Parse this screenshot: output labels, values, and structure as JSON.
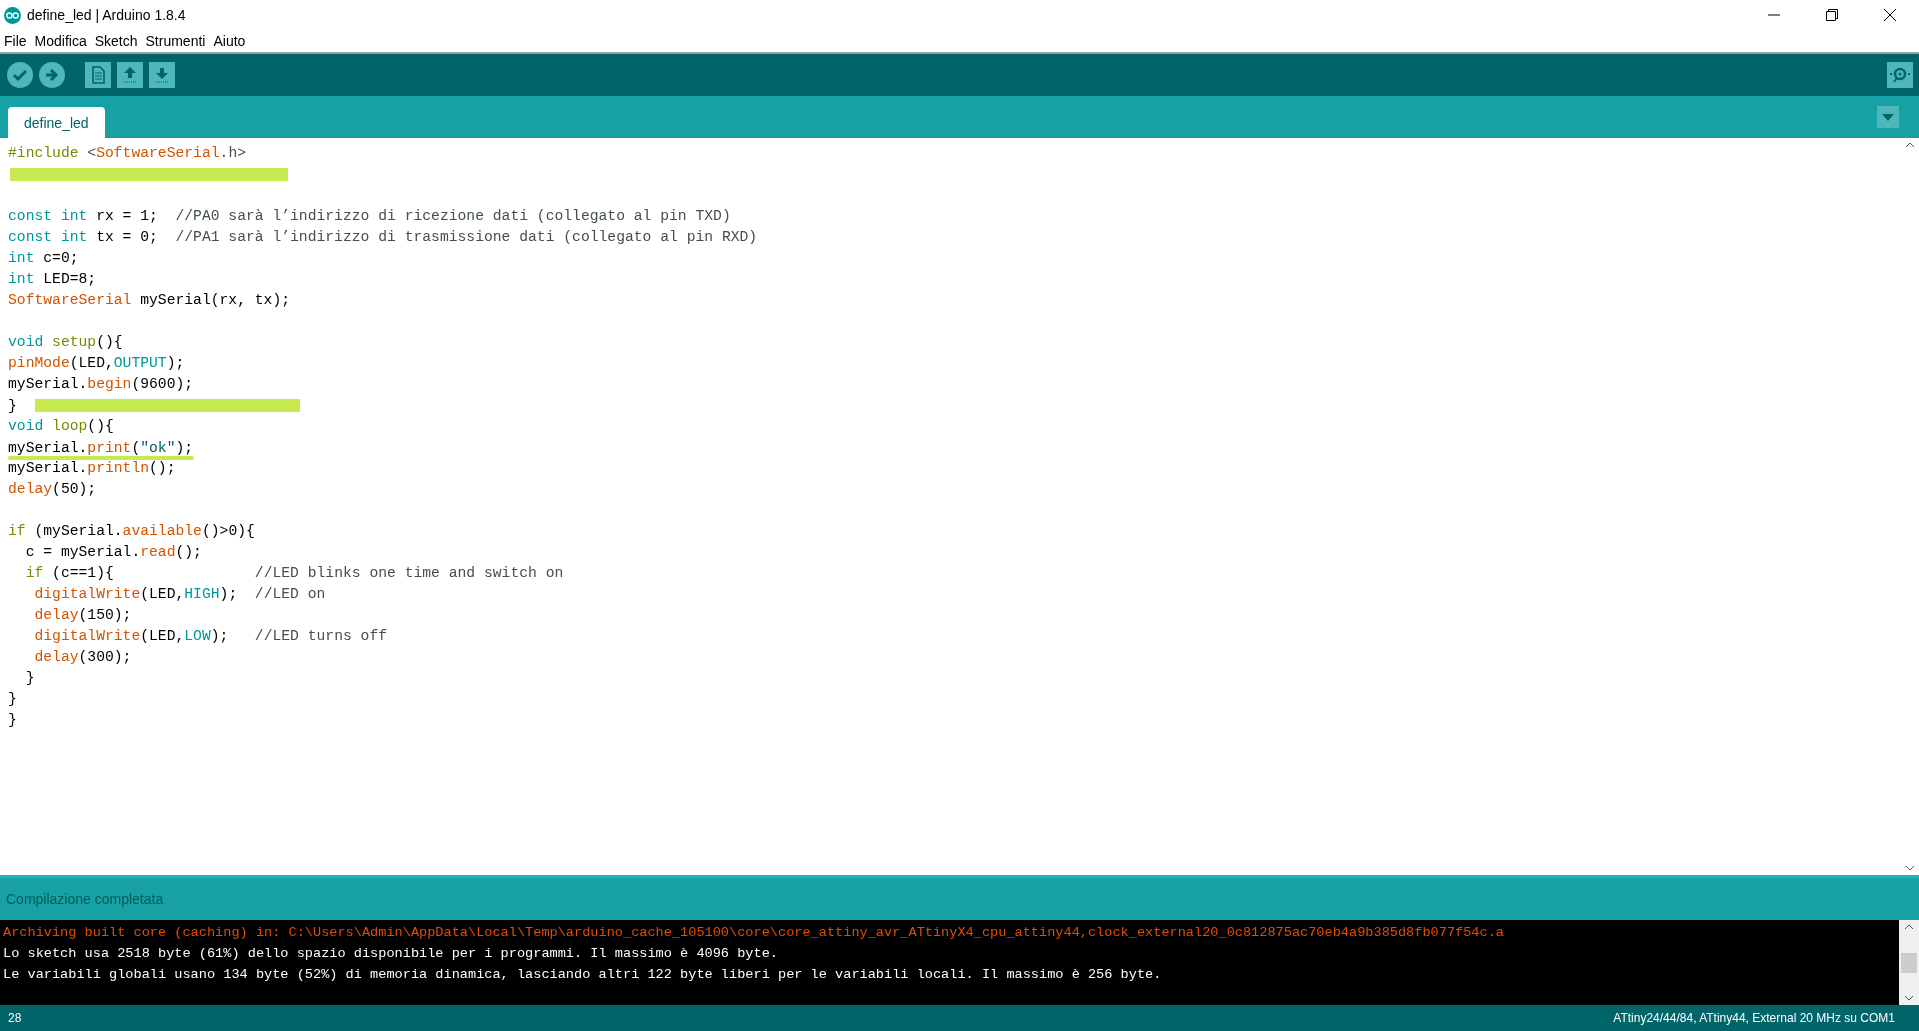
{
  "window": {
    "title": "define_led | Arduino 1.8.4"
  },
  "menu": [
    "File",
    "Modifica",
    "Sketch",
    "Strumenti",
    "Aiuto"
  ],
  "toolbar": [
    {
      "kind": "verify"
    },
    {
      "kind": "upload"
    },
    {
      "kind": "new"
    },
    {
      "kind": "open"
    },
    {
      "kind": "save"
    }
  ],
  "tabs": [
    {
      "label": "define_led",
      "selected": true
    }
  ],
  "editor": {
    "lines": [
      {
        "tokens": [
          {
            "kind": "control",
            "text": "#include"
          },
          {
            "kind": "comment",
            "text": " <"
          },
          {
            "kind": "func",
            "text": "SoftwareSerial"
          },
          {
            "kind": "comment",
            "text": ".h>"
          }
        ]
      },
      {
        "kind": "blank",
        "highlight": {
          "kind": "bar"
        }
      },
      {
        "kind": "blank"
      },
      {
        "tokens": [
          {
            "kind": "keyword",
            "text": "const int"
          },
          {
            "kind": "plain",
            "text": " rx = 1;  "
          },
          {
            "kind": "comment",
            "text": "//PA0 sarà l’indirizzo di ricezione dati (collegato al pin TXD)"
          }
        ]
      },
      {
        "tokens": [
          {
            "kind": "keyword",
            "text": "const int"
          },
          {
            "kind": "plain",
            "text": " tx = 0;  "
          },
          {
            "kind": "comment",
            "text": "//PA1 sarà l’indirizzo di trasmissione dati (collegato al pin RXD)"
          }
        ]
      },
      {
        "tokens": [
          {
            "kind": "keyword",
            "text": "int"
          },
          {
            "kind": "plain",
            "text": " c=0;"
          }
        ]
      },
      {
        "tokens": [
          {
            "kind": "keyword",
            "text": "int"
          },
          {
            "kind": "plain",
            "text": " LED=8;"
          }
        ]
      },
      {
        "tokens": [
          {
            "kind": "func",
            "text": "SoftwareSerial"
          },
          {
            "kind": "plain",
            "text": " mySerial(rx, tx);"
          }
        ]
      },
      {
        "kind": "blank"
      },
      {
        "tokens": [
          {
            "kind": "keyword",
            "text": "void "
          },
          {
            "kind": "control",
            "text": "setup"
          },
          {
            "kind": "plain",
            "text": "(){"
          }
        ]
      },
      {
        "tokens": [
          {
            "kind": "func",
            "text": "pinMode"
          },
          {
            "kind": "plain",
            "text": "(LED,"
          },
          {
            "kind": "constant",
            "text": "OUTPUT"
          },
          {
            "kind": "plain",
            "text": ");"
          }
        ]
      },
      {
        "tokens": [
          {
            "kind": "plain",
            "text": "mySerial."
          },
          {
            "kind": "func",
            "text": "begin"
          },
          {
            "kind": "plain",
            "text": "(9600);"
          }
        ]
      },
      {
        "tokens": [
          {
            "kind": "plain",
            "text": "}"
          }
        ],
        "highlight": {
          "kind": "bar"
        }
      },
      {
        "tokens": [
          {
            "kind": "keyword",
            "text": "void "
          },
          {
            "kind": "control",
            "text": "loop"
          },
          {
            "kind": "plain",
            "text": "(){"
          }
        ]
      },
      {
        "tokens": [
          {
            "kind": "plain",
            "text": "mySerial."
          },
          {
            "kind": "func",
            "text": "print"
          },
          {
            "kind": "plain",
            "text": "("
          },
          {
            "kind": "string",
            "text": "\"ok\""
          },
          {
            "kind": "plain",
            "text": ");"
          }
        ],
        "highlight": {
          "kind": "underline"
        }
      },
      {
        "tokens": [
          {
            "kind": "plain",
            "text": "mySerial."
          },
          {
            "kind": "func",
            "text": "println"
          },
          {
            "kind": "plain",
            "text": "();"
          }
        ]
      },
      {
        "tokens": [
          {
            "kind": "func",
            "text": "delay"
          },
          {
            "kind": "plain",
            "text": "(50);"
          }
        ]
      },
      {
        "kind": "blank"
      },
      {
        "tokens": [
          {
            "kind": "control",
            "text": "if"
          },
          {
            "kind": "plain",
            "text": " (mySerial."
          },
          {
            "kind": "func",
            "text": "available"
          },
          {
            "kind": "plain",
            "text": "()>0){"
          }
        ]
      },
      {
        "tokens": [
          {
            "kind": "plain",
            "text": "  c = mySerial."
          },
          {
            "kind": "func",
            "text": "read"
          },
          {
            "kind": "plain",
            "text": "();"
          }
        ]
      },
      {
        "tokens": [
          {
            "kind": "control",
            "text": "  if"
          },
          {
            "kind": "plain",
            "text": " (c==1){                "
          },
          {
            "kind": "comment",
            "text": "//LED blinks one time and switch on"
          }
        ]
      },
      {
        "tokens": [
          {
            "kind": "func",
            "text": "   digitalWrite"
          },
          {
            "kind": "plain",
            "text": "(LED,"
          },
          {
            "kind": "constant",
            "text": "HIGH"
          },
          {
            "kind": "plain",
            "text": ");  "
          },
          {
            "kind": "comment",
            "text": "//LED on"
          }
        ]
      },
      {
        "tokens": [
          {
            "kind": "func",
            "text": "   delay"
          },
          {
            "kind": "plain",
            "text": "(150);"
          }
        ]
      },
      {
        "tokens": [
          {
            "kind": "func",
            "text": "   digitalWrite"
          },
          {
            "kind": "plain",
            "text": "(LED,"
          },
          {
            "kind": "constant",
            "text": "LOW"
          },
          {
            "kind": "plain",
            "text": ");   "
          },
          {
            "kind": "comment",
            "text": "//LED turns off"
          }
        ]
      },
      {
        "tokens": [
          {
            "kind": "func",
            "text": "   delay"
          },
          {
            "kind": "plain",
            "text": "(300);"
          }
        ]
      },
      {
        "tokens": [
          {
            "kind": "plain",
            "text": "  }"
          }
        ]
      },
      {
        "tokens": [
          {
            "kind": "plain",
            "text": "}"
          }
        ]
      },
      {
        "tokens": [
          {
            "kind": "plain",
            "text": "}"
          }
        ]
      }
    ]
  },
  "status": "Compilazione completata",
  "console": [
    {
      "kind": "error",
      "text": "Archiving built core (caching) in: C:\\Users\\Admin\\AppData\\Local\\Temp\\arduino_cache_105100\\core\\core_attiny_avr_ATtinyX4_cpu_attiny44,clock_external20_0c812875ac70eb4a9b385d8fb077f54c.a"
    },
    {
      "kind": "info",
      "text": "Lo sketch usa 2518 byte (61%) dello spazio disponibile per i programmi. Il massimo è 4096 byte."
    },
    {
      "kind": "info",
      "text": "Le variabili globali usano 134 byte (52%) di memoria dinamica, lasciando altri 122 byte liberi per le variabili locali. Il massimo è 256 byte."
    }
  ],
  "footer": {
    "line": "28",
    "board": "ATtiny24/44/84, ATtiny44, External 20 MHz su COM1"
  }
}
